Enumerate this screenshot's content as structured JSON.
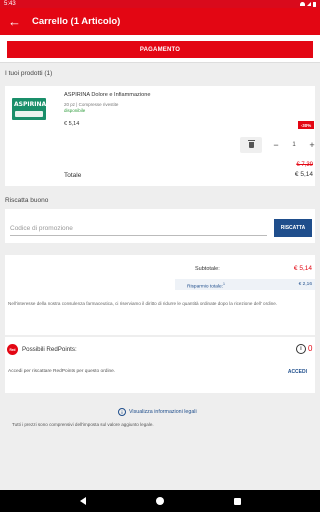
{
  "status_bar": {
    "time": "5:43"
  },
  "app_bar": {
    "title": "Carrello (1 Articolo)",
    "back_icon": "arrow-back-icon"
  },
  "payment": {
    "button_label": "PAGAMENTO"
  },
  "products_section": {
    "label": "I tuoi prodotti (1)"
  },
  "product": {
    "image_brand": "ASPIRINA",
    "name": "ASPIRINA Dolore e Infiammazione",
    "description": "20 pz | Compresse rivestite",
    "availability": "disponibile",
    "price": "€ 5,14",
    "discount_badge": "-30%",
    "quantity": "1",
    "old_price": "€ 7,39",
    "total_label": "Totale",
    "total_value": "€ 5,14"
  },
  "coupon": {
    "section_label": "Riscatta buono",
    "placeholder": "Codice di promozione",
    "button_label": "RISCATTA"
  },
  "summary": {
    "subtotal_label": "Subtotale:",
    "subtotal_value": "€ 5,14",
    "savings_label": "Risparmio totale:",
    "savings_sup": "1",
    "savings_value": "€ 2,16",
    "notice": "Nell'interesse della nostra consulenza farmaceutica, ci riserviamo il diritto di ridurre le quantità ordinate dopo la ricezione dell' ordine."
  },
  "redpoints": {
    "logo_text": "Red",
    "title": "Possibili RedPoints:",
    "info_icon": "i",
    "count": "0",
    "subtext": "Accedi per riscattare RedPoints per questo ordine.",
    "login_label": "ACCEDI"
  },
  "legal": {
    "link_label": "Visualizza informazioni legali",
    "vat_note": "Tutti i prezzi sono comprensivi dell'imposta sul valore aggiunto legale."
  },
  "colors": {
    "brand_red": "#e30613",
    "action_blue": "#1f4e8c",
    "available_green": "#2e9b3b"
  }
}
